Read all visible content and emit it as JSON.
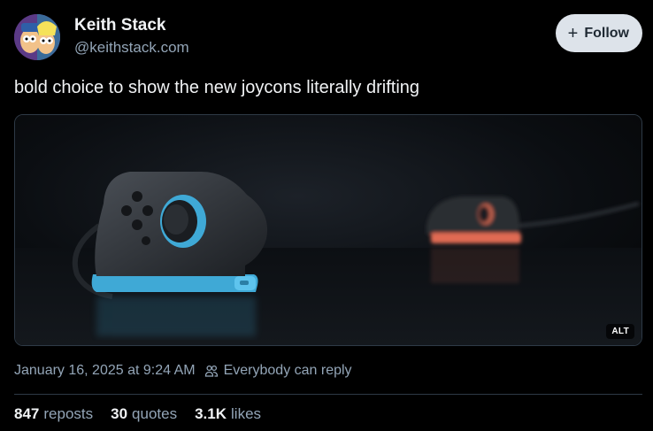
{
  "author": {
    "display_name": "Keith Stack",
    "handle": "@keithstack.com",
    "avatar_icon": "cartoon-avatar-icon"
  },
  "follow": {
    "label": "Follow",
    "icon": "plus-icon"
  },
  "post": {
    "text": "bold choice to show the new joycons literally drifting",
    "media": {
      "alt_badge": "ALT",
      "description_icon": "joycon-photo"
    },
    "timestamp": "January 16, 2025 at 9:24 AM",
    "reply_setting": "Everybody can reply",
    "reply_setting_icon": "people-icon"
  },
  "stats": {
    "reposts_count": "847",
    "reposts_label": "reposts",
    "quotes_count": "30",
    "quotes_label": "quotes",
    "likes_count": "3.1K",
    "likes_label": "likes"
  },
  "colors": {
    "background": "#000000",
    "text_primary": "#f1f3f5",
    "text_secondary": "#93a5b7",
    "follow_bg": "#dde3ea",
    "border": "#2e3a46",
    "joycon_blue": "#3fa9d6",
    "joycon_red": "#e06a52"
  }
}
